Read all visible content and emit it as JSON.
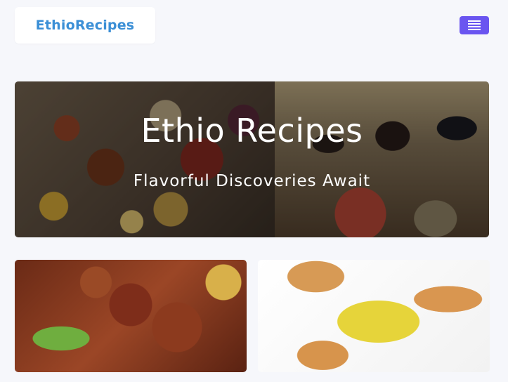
{
  "header": {
    "brand": "EthioRecipes",
    "menu_icon": "hamburger-menu-icon"
  },
  "hero": {
    "title": "Ethio Recipes",
    "subtitle": "Flavorful Discoveries Await"
  },
  "cards": [
    {
      "image": "meat-tibs-dish-photo"
    },
    {
      "image": "egg-scramble-with-bread-photo"
    }
  ],
  "colors": {
    "brand": "#3b8fd6",
    "menu_button": "#6a55f0",
    "page_background": "#f6f7fb"
  }
}
